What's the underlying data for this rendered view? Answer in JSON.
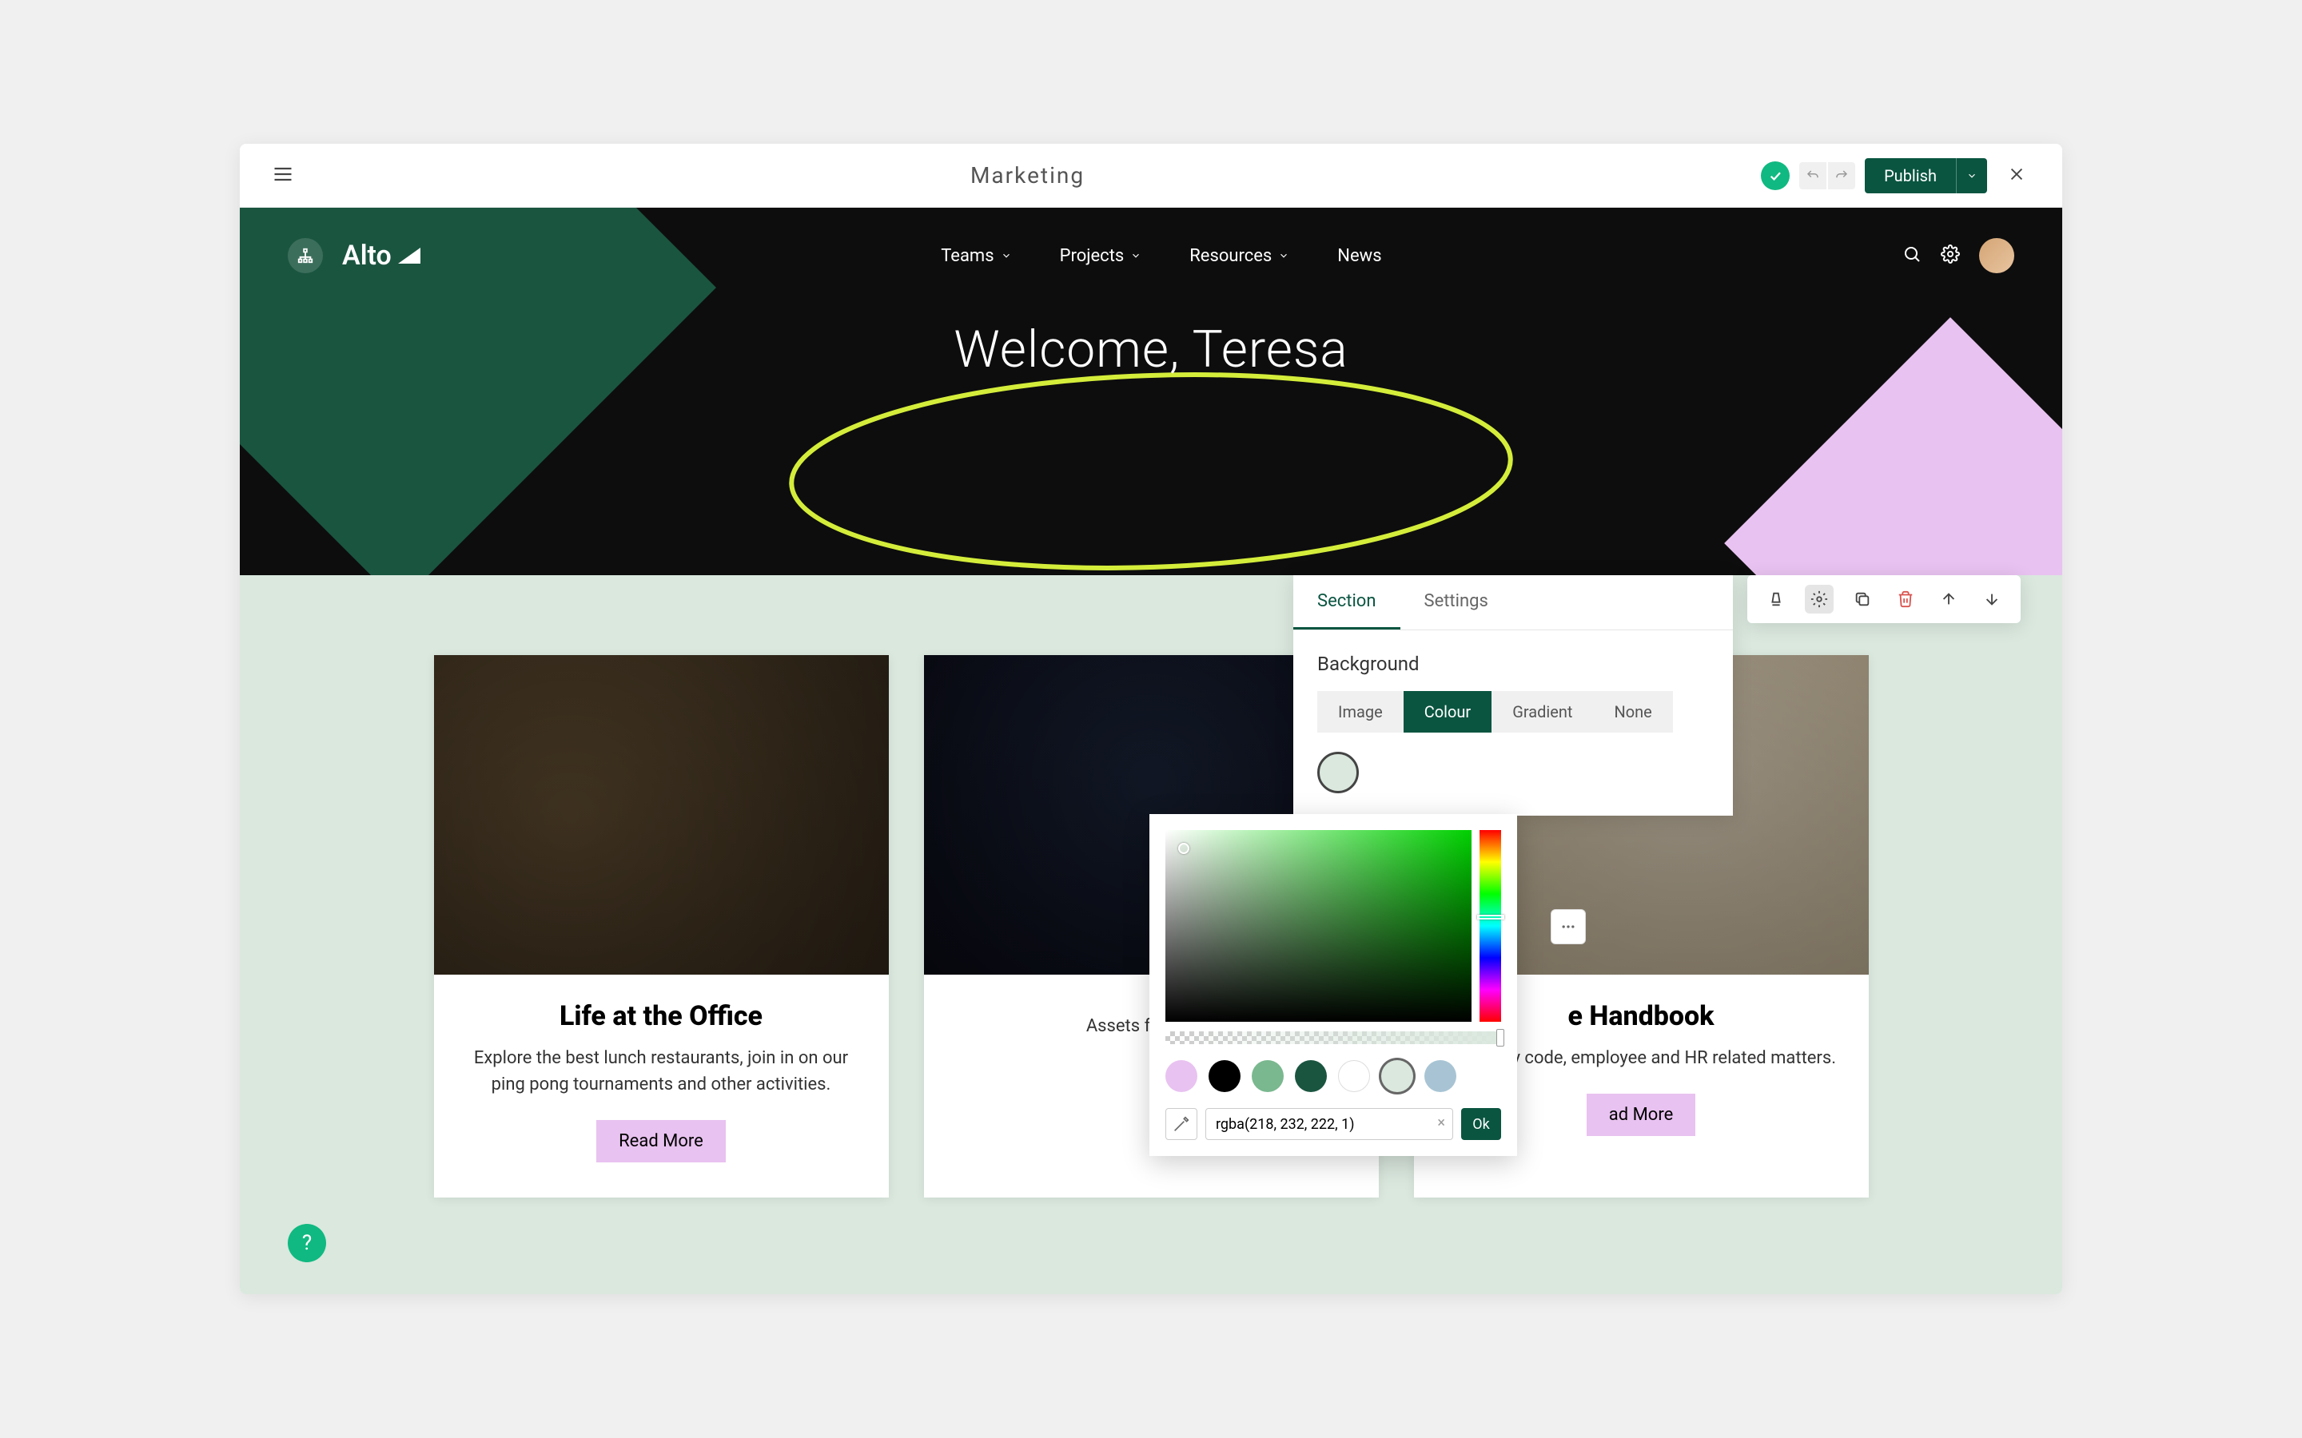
{
  "toolbar": {
    "title": "Marketing",
    "publish_label": "Publish"
  },
  "hero": {
    "logo_text": "Alto",
    "nav": {
      "teams": "Teams",
      "projects": "Projects",
      "resources": "Resources",
      "news": "News"
    },
    "welcome": "Welcome, Teresa"
  },
  "cards": [
    {
      "title": "Life at the Office",
      "desc": "Explore the best lunch restaurants, join in on our ping pong tournaments and other activities.",
      "button": "Read More"
    },
    {
      "title": "",
      "desc": "Assets for SoMe",
      "button": ""
    },
    {
      "title": "e Handbook",
      "desc": "Company code, employee and HR related matters.",
      "button": "ad More"
    }
  ],
  "section_panel": {
    "tabs": {
      "section": "Section",
      "settings": "Settings"
    },
    "background_label": "Background",
    "bg_types": {
      "image": "Image",
      "colour": "Colour",
      "gradient": "Gradient",
      "none": "None"
    }
  },
  "color_picker": {
    "value": "rgba(218, 232, 222, 1)",
    "ok": "Ok",
    "swatches": [
      "#e8c2f0",
      "#000000",
      "#7ab88f",
      "#1a5540",
      "#ffffff",
      "#dae8de",
      "#a8c4d4"
    ]
  },
  "help": "?",
  "colors": {
    "accent_green": "#0a5540",
    "accent_pink": "#e8c2f0",
    "section_bg": "#dae8de",
    "status_green": "#10b981"
  }
}
